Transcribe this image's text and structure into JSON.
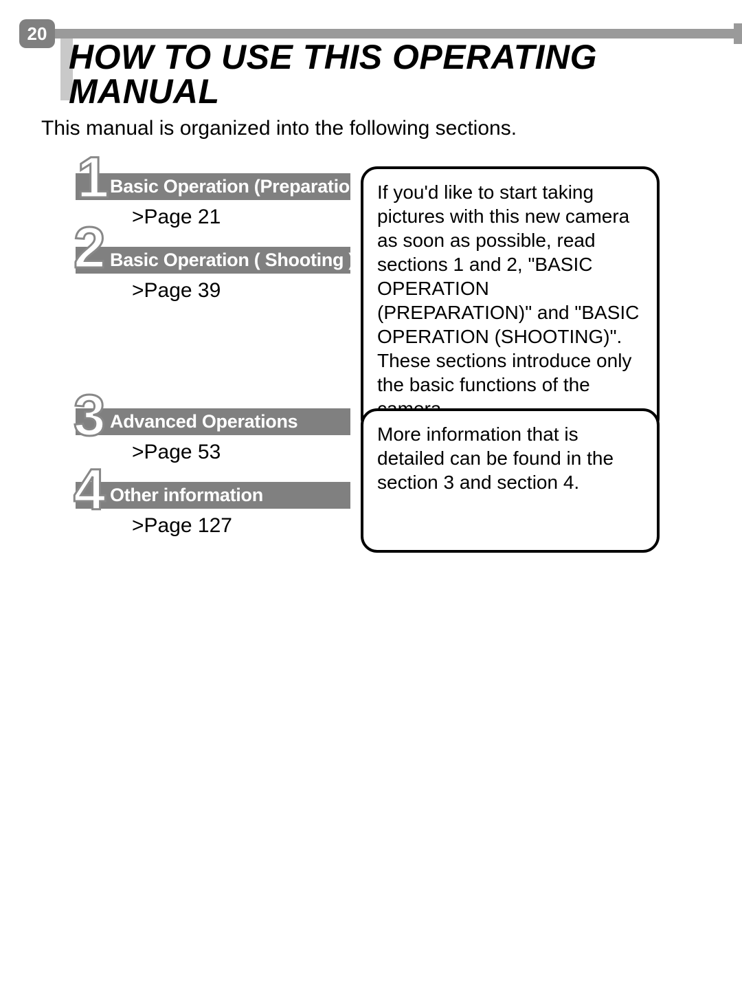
{
  "page_number": "20",
  "title": "HOW TO USE THIS OPERATING MANUAL",
  "intro": "This manual is organized into the following sections.",
  "sections": [
    {
      "num": "1",
      "label": "Basic Operation (Preparation)",
      "page_ref": ">Page 21"
    },
    {
      "num": "2",
      "label": "Basic Operation ( Shooting )",
      "page_ref": ">Page 39"
    },
    {
      "num": "3",
      "label": "Advanced Operations",
      "page_ref": ">Page 53"
    },
    {
      "num": "4",
      "label": "Other information",
      "page_ref": ">Page 127"
    }
  ],
  "callouts": [
    "If you'd like to start taking pictures with this new camera as soon as possible, read sections 1 and 2, \"BASIC OPERATION (PREPARATION)\" and \"BASIC OPERATION (SHOOTING)\". These sections introduce only the basic functions of the camera.",
    "More information that is detailed can be found in the section 3 and section 4."
  ]
}
